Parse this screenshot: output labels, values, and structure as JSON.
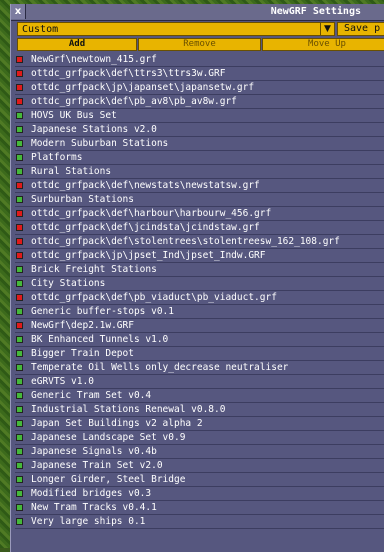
{
  "window": {
    "title": "NewGRF Settings",
    "close_label": "x"
  },
  "preset": {
    "value": "Custom",
    "save_label": "Save p"
  },
  "buttons": {
    "add": "Add",
    "remove": "Remove",
    "move_up": "Move Up"
  },
  "grfs": [
    {
      "name": "NewGrf\\newtown_415.grf",
      "status": "red"
    },
    {
      "name": "ottdc_grfpack\\def\\ttrs3\\ttrs3w.GRF",
      "status": "red"
    },
    {
      "name": "ottdc_grfpack\\jp\\japanset\\japansetw.grf",
      "status": "red"
    },
    {
      "name": "ottdc_grfpack\\def\\pb_av8\\pb_av8w.grf",
      "status": "red"
    },
    {
      "name": "HOVS UK Bus Set",
      "status": "green"
    },
    {
      "name": "Japanese Stations v2.0",
      "status": "green"
    },
    {
      "name": "Modern Suburban Stations",
      "status": "green"
    },
    {
      "name": "Platforms",
      "status": "green"
    },
    {
      "name": "Rural Stations",
      "status": "green"
    },
    {
      "name": "ottdc_grfpack\\def\\newstats\\newstatsw.grf",
      "status": "red"
    },
    {
      "name": "Surburban Stations",
      "status": "green"
    },
    {
      "name": "ottdc_grfpack\\def\\harbour\\harbourw_456.grf",
      "status": "red"
    },
    {
      "name": "ottdc_grfpack\\def\\jcindsta\\jcindstaw.grf",
      "status": "red"
    },
    {
      "name": "ottdc_grfpack\\def\\stolentrees\\stolentreesw_162_108.grf",
      "status": "red"
    },
    {
      "name": "ottdc_grfpack\\jp\\jpset_Ind\\jpset_Indw.GRF",
      "status": "red"
    },
    {
      "name": "Brick Freight Stations",
      "status": "green"
    },
    {
      "name": "City Stations",
      "status": "green"
    },
    {
      "name": "ottdc_grfpack\\def\\pb_viaduct\\pb_viaduct.grf",
      "status": "red"
    },
    {
      "name": "Generic buffer-stops v0.1",
      "status": "green"
    },
    {
      "name": "NewGrf\\dep2.1w.GRF",
      "status": "red"
    },
    {
      "name": "BK Enhanced Tunnels v1.0",
      "status": "green"
    },
    {
      "name": "Bigger Train Depot",
      "status": "green"
    },
    {
      "name": " Temperate Oil Wells only_decrease neutraliser",
      "status": "green"
    },
    {
      "name": "eGRVTS v1.0",
      "status": "green"
    },
    {
      "name": "Generic Tram Set v0.4",
      "status": "green"
    },
    {
      "name": "Industrial Stations Renewal v0.8.0",
      "status": "green"
    },
    {
      "name": "Japan Set Buildings v2 alpha 2",
      "status": "green"
    },
    {
      "name": "Japanese Landscape Set v0.9",
      "status": "green"
    },
    {
      "name": "Japanese Signals v0.4b",
      "status": "green"
    },
    {
      "name": "Japanese Train Set v2.0",
      "status": "green"
    },
    {
      "name": "Longer Girder, Steel Bridge",
      "status": "green"
    },
    {
      "name": "Modified bridges v0.3",
      "status": "green"
    },
    {
      "name": "New Tram Tracks v0.4.1",
      "status": "green"
    },
    {
      "name": "Very large ships 0.1",
      "status": "green"
    }
  ],
  "colors": {
    "ok": "#45b83a",
    "error": "#e01a1a",
    "accent": "#e8b400",
    "panel": "#56577f"
  }
}
